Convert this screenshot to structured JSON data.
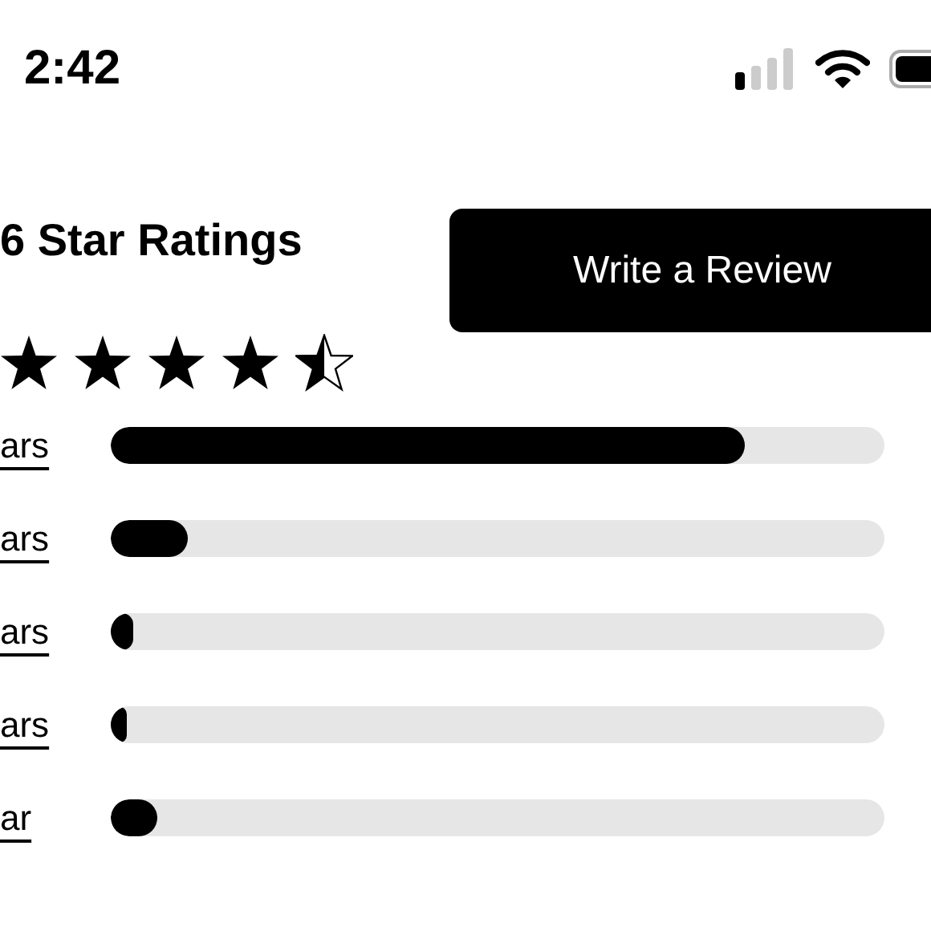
{
  "status_bar": {
    "time": "2:42"
  },
  "ratings": {
    "title": "6 Star Ratings",
    "stars": 4.5
  },
  "write_review_button": {
    "label": "Write a Review"
  },
  "distribution": [
    {
      "label": "ars",
      "level": 0.82
    },
    {
      "label": "ars",
      "level": 0.1
    },
    {
      "label": "ars",
      "level": 0.03
    },
    {
      "label": "ars",
      "level": 0.02
    },
    {
      "label": "ar",
      "level": 0.06
    }
  ]
}
